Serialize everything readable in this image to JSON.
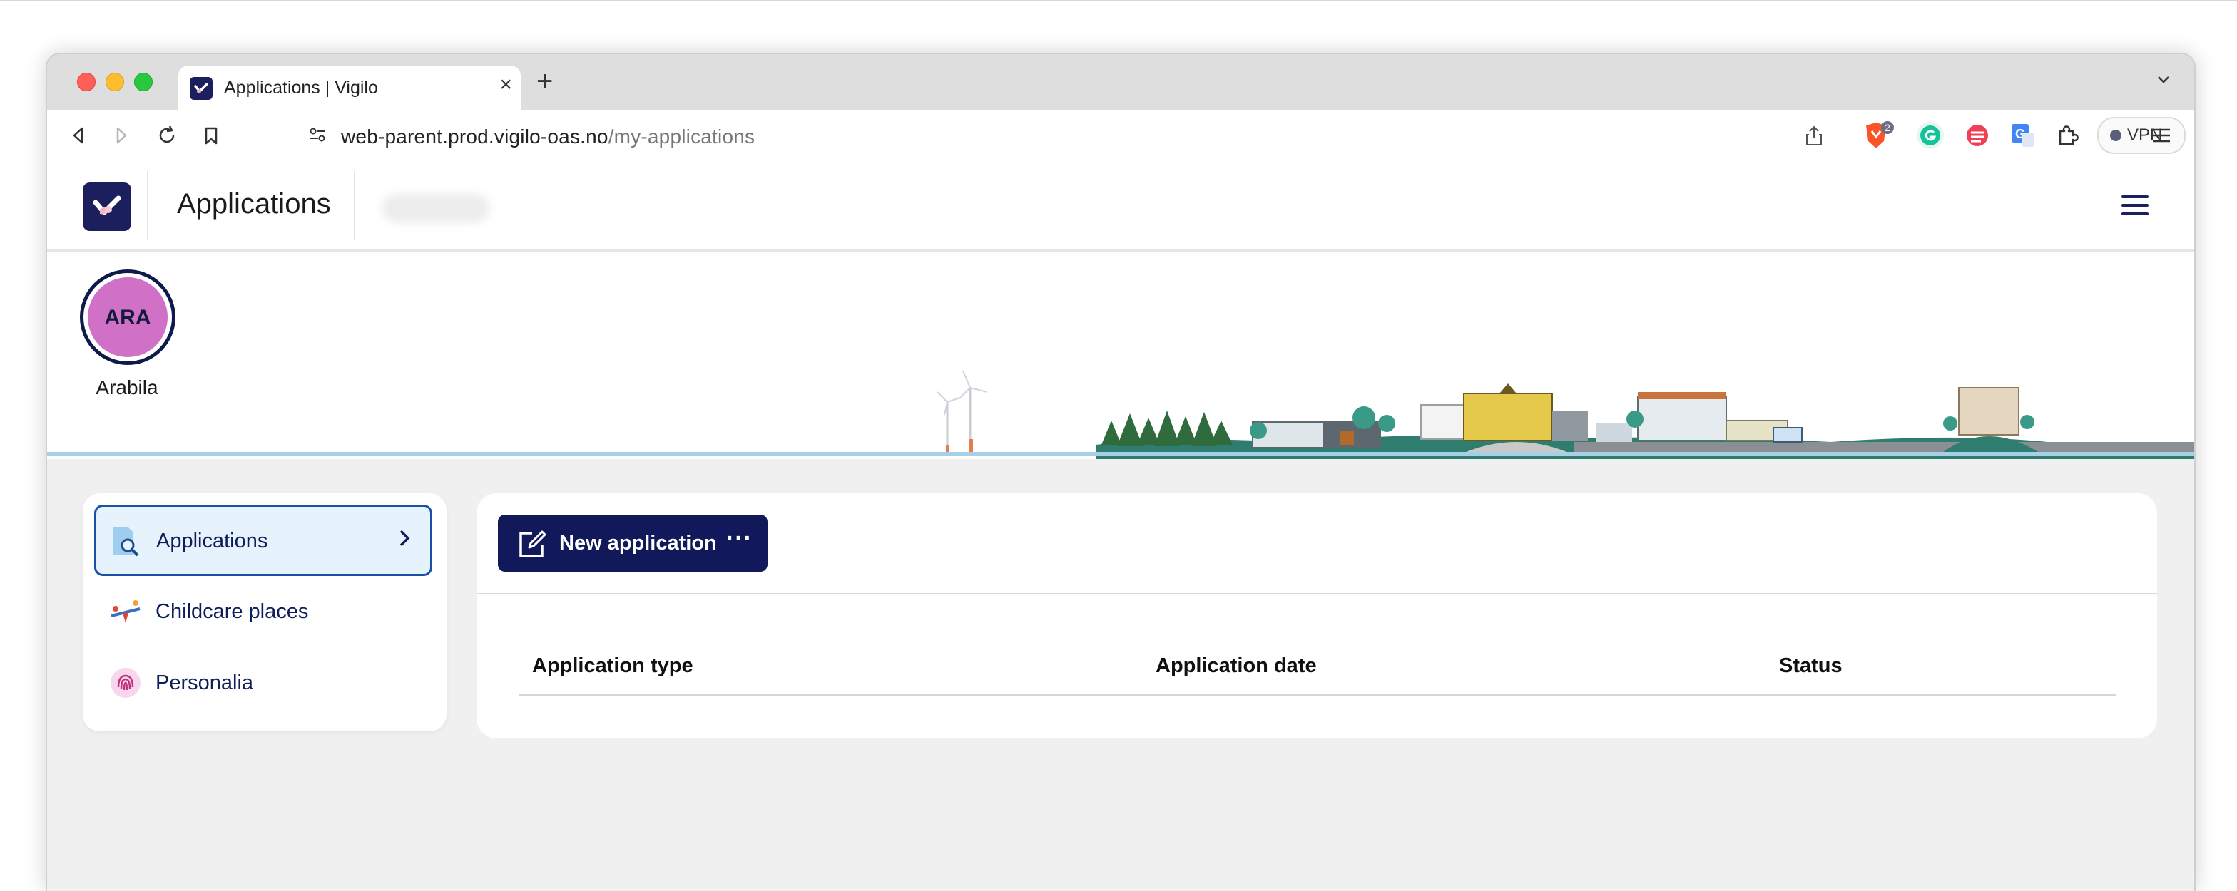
{
  "browser": {
    "tab_title": "Applications | Vigilo",
    "tab_close": "×",
    "new_tab": "+",
    "tab_list": "⌄",
    "url_domain": "web-parent.prod.vigilo-oas.no",
    "url_path": "/my-applications",
    "brave_badge": "2",
    "vpn_label": "VPN"
  },
  "header": {
    "title": "Applications"
  },
  "profile": {
    "initials": "ARA",
    "name": "Arabila",
    "avatar_color": "#d070c6"
  },
  "sidebar": {
    "items": [
      {
        "label": "Applications",
        "icon": "document-search-icon",
        "active": true
      },
      {
        "label": "Childcare places",
        "icon": "seesaw-icon",
        "active": false
      },
      {
        "label": "Personalia",
        "icon": "fingerprint-icon",
        "active": false
      }
    ],
    "chevron": "›"
  },
  "main": {
    "new_application_label": "New application",
    "more_label": "···",
    "table": {
      "columns": [
        "Application type",
        "Application date",
        "Status"
      ],
      "rows": []
    }
  },
  "colors": {
    "brand_navy": "#12195a",
    "active_border": "#1653a8",
    "active_bg": "#e6f3fc"
  }
}
